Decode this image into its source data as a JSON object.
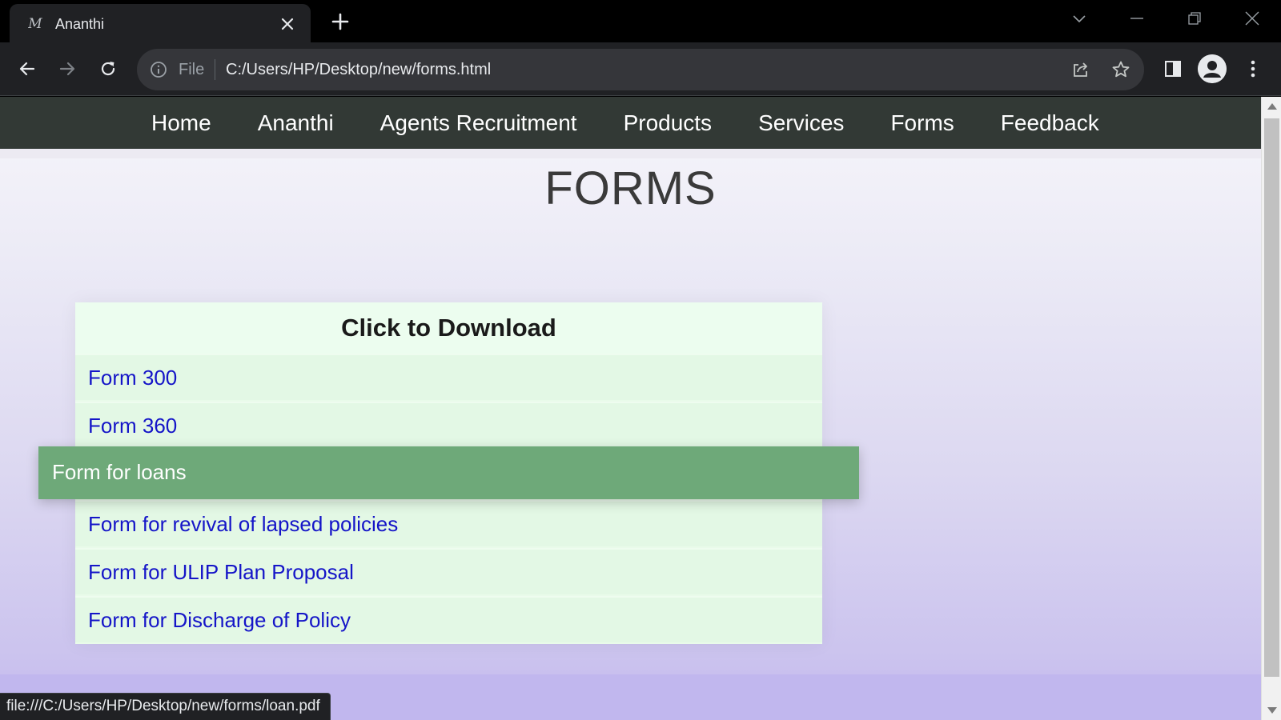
{
  "browser": {
    "tab": {
      "title": "Ananthi",
      "favicon": "M"
    },
    "omnibox": {
      "security_label": "File",
      "url": "C:/Users/HP/Desktop/new/forms.html"
    }
  },
  "nav": {
    "items": [
      {
        "label": "Home"
      },
      {
        "label": "Ananthi"
      },
      {
        "label": "Agents Recruitment"
      },
      {
        "label": "Products"
      },
      {
        "label": "Services"
      },
      {
        "label": "Forms"
      },
      {
        "label": "Feedback"
      }
    ]
  },
  "page": {
    "title": "FORMS",
    "download_heading": "Click to Download",
    "forms": [
      {
        "label": "Form 300"
      },
      {
        "label": "Form 360"
      },
      {
        "label": "Form for loans",
        "hovered": true
      },
      {
        "label": "Form for revival of lapsed policies"
      },
      {
        "label": "Form for ULIP Plan Proposal"
      },
      {
        "label": "Form for Discharge of Policy"
      }
    ]
  },
  "status_bar": {
    "url": "file:///C:/Users/HP/Desktop/new/forms/loan.pdf"
  },
  "colors": {
    "navbar": "#323935",
    "hover_row": "#6ea979",
    "link": "#1515c8",
    "form_box": "#e9fbea"
  }
}
